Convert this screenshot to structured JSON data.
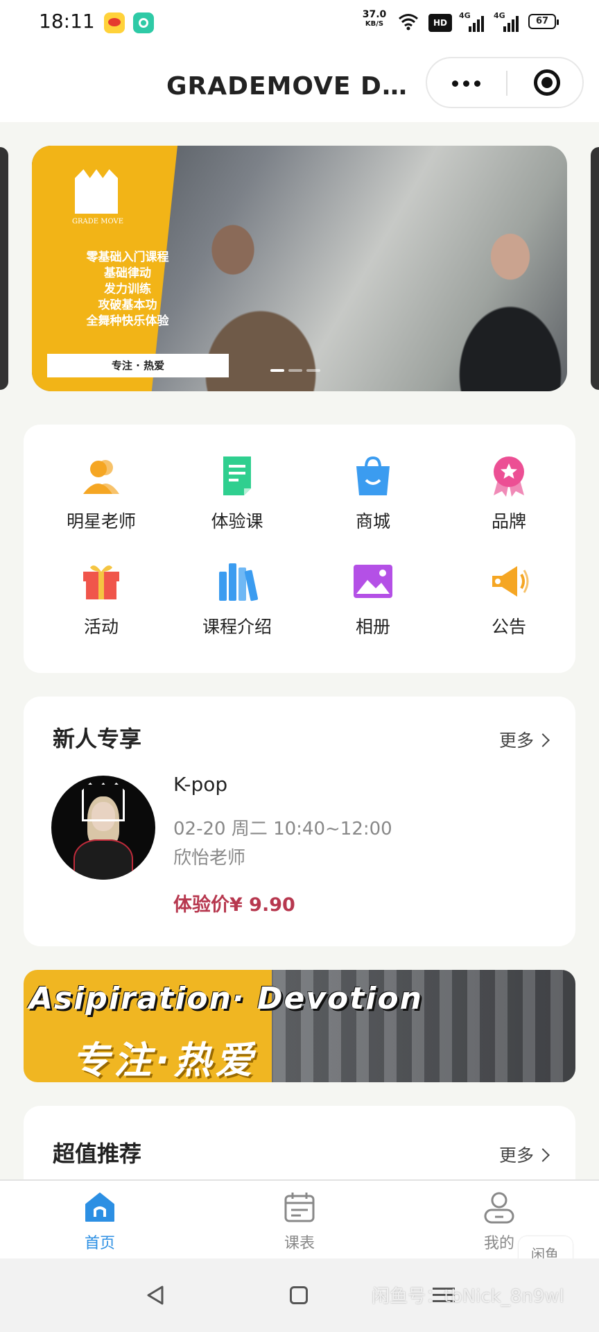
{
  "status_bar": {
    "time": "18:11",
    "speed": "37.0",
    "speed_unit": "KB/S",
    "hd": "HD",
    "net1": "4G",
    "net2": "4G",
    "battery": "67"
  },
  "header": {
    "title": "GRADEMOVE DA..."
  },
  "banner": {
    "brand": "GRADE MOVE",
    "lines": [
      "零基础入门课程",
      "基础律动",
      "发力训练",
      "攻破基本功",
      "全舞种快乐体验"
    ],
    "tagline": "专注 · 热爱"
  },
  "grid": [
    {
      "label": "明星老师",
      "icon": "star-teacher-icon",
      "color": "#f5a623"
    },
    {
      "label": "体验课",
      "icon": "trial-class-icon",
      "color": "#2fcf8f"
    },
    {
      "label": "商城",
      "icon": "shopping-bag-icon",
      "color": "#3b9cf0"
    },
    {
      "label": "品牌",
      "icon": "brand-badge-icon",
      "color": "#ec4f94"
    },
    {
      "label": "活动",
      "icon": "gift-icon",
      "color": "#f0554b"
    },
    {
      "label": "课程介绍",
      "icon": "books-icon",
      "color": "#3b9cf0"
    },
    {
      "label": "相册",
      "icon": "photo-album-icon",
      "color": "#b450e6"
    },
    {
      "label": "公告",
      "icon": "announcement-icon",
      "color": "#f5a623"
    }
  ],
  "newbie": {
    "title": "新人专享",
    "more": "更多",
    "course": {
      "name": "K-pop",
      "time": "02-20 周二 10:40~12:00",
      "teacher": "欣怡老师",
      "price": "体验价¥ 9.90"
    }
  },
  "promo": {
    "en": "Asipiration· Devotion",
    "cn": "专注·热爱"
  },
  "recommend": {
    "title": "超值推荐",
    "more": "更多"
  },
  "tabbar": [
    {
      "label": "首页",
      "active": true
    },
    {
      "label": "课表",
      "active": false
    },
    {
      "label": "我的",
      "active": false
    }
  ],
  "watermark": "闲鱼号：tbNick_8n9wl",
  "watermark_badge": "闲鱼"
}
